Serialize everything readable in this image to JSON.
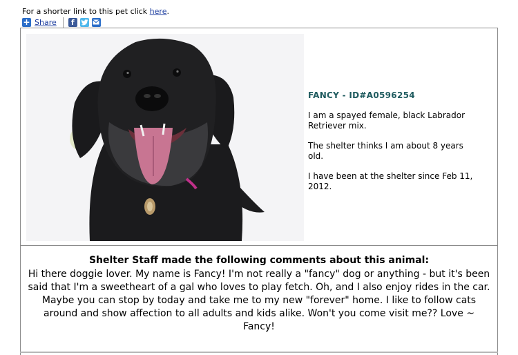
{
  "short_link": {
    "prefix": "For a shorter link to this pet click ",
    "link_label": "here",
    "suffix": "."
  },
  "share": {
    "share_label": "Share",
    "icons": [
      "plus-icon",
      "facebook-icon",
      "twitter-icon",
      "email-icon"
    ]
  },
  "pet": {
    "title": "FANCY - ID#A0596254",
    "description_1": "I am a spayed female, black Labrador Retriever mix.",
    "description_2": "The shelter thinks I am about 8 years old.",
    "description_3": "I have been at the shelter since Feb 11, 2012."
  },
  "comments": {
    "heading": "Shelter Staff made the following comments about this animal:",
    "text": "Hi there doggie lover. My name is Fancy! I'm not really a \"fancy\" dog or anything - but it's been said that I'm a sweetheart of a gal who loves to play fetch. Oh, and I also enjoy rides in the car. Maybe you can stop by today and take me to my new \"forever\" home. I like to follow cats around and show affection to all adults and kids alike. Won't you come visit me?? Love ~ Fancy!"
  },
  "colors": {
    "title_color": "#1f5b5f",
    "link_color": "#1a3b9e",
    "border_color": "#8a8a8a"
  }
}
